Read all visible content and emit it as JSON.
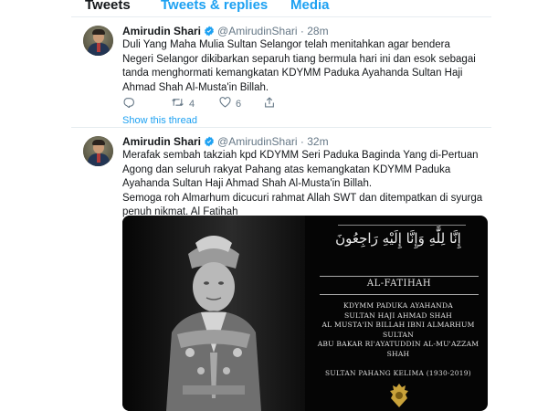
{
  "tabs": [
    {
      "label": "Tweets",
      "active": true
    },
    {
      "label": "Tweets & replies",
      "active": false
    },
    {
      "label": "Media",
      "active": false
    }
  ],
  "colors": {
    "accent": "#1da1f2",
    "secondary_text": "#657786",
    "text": "#14171a"
  },
  "tweets": [
    {
      "name": "Amirudin Shari",
      "handle": "@AmirudinShari",
      "separator": "·",
      "time": "28m",
      "text": "Duli Yang Maha Mulia Sultan Selangor telah menitahkan agar bendera Negeri Selangor dikibarkan separuh tiang bermula hari ini dan esok sebagai tanda menghormati kemangkatan KDYMM Paduka Ayahanda Sultan Haji Ahmad Shah Al-Musta'in Billah.",
      "retweets": "4",
      "likes": "6",
      "show_thread": "Show this thread",
      "icons": [
        "reply-icon",
        "retweet-icon",
        "like-icon",
        "share-icon"
      ]
    },
    {
      "name": "Amirudin Shari",
      "handle": "@AmirudinShari",
      "separator": "·",
      "time": "32m",
      "text_1": "Merafak sembah takziah kpd KDYMM Seri Paduka Baginda Yang di-Pertuan Agong dan seluruh rakyat Pahang atas kemangkatan KDYMM Paduka Ayahanda Sultan Haji Ahmad Shah Al-Musta'in Billah.",
      "text_2": "Semoga roh Almarhum dicucuri rahmat Allah SWT dan ditempatkan di syurga penuh nikmat. Al Fatihah",
      "image": {
        "arabic": "إِنَّا لِلَّٰهِ وَإِنَّا إِلَيْهِ رَاجِعُونَ",
        "fatihah": "AL-FATIHAH",
        "royal_lines": [
          "KDYMM PADUKA AYAHANDA",
          "SULTAN HAJI AHMAD SHAH",
          "AL MUSTA'IN BILLAH IBNI ALMARHUM SULTAN",
          "ABU BAKAR RI'AYATUDDIN AL-MU'AZZAM SHAH"
        ],
        "sultan_pahang": "SULTAN PAHANG KELIMA (1930-2019)"
      }
    }
  ]
}
